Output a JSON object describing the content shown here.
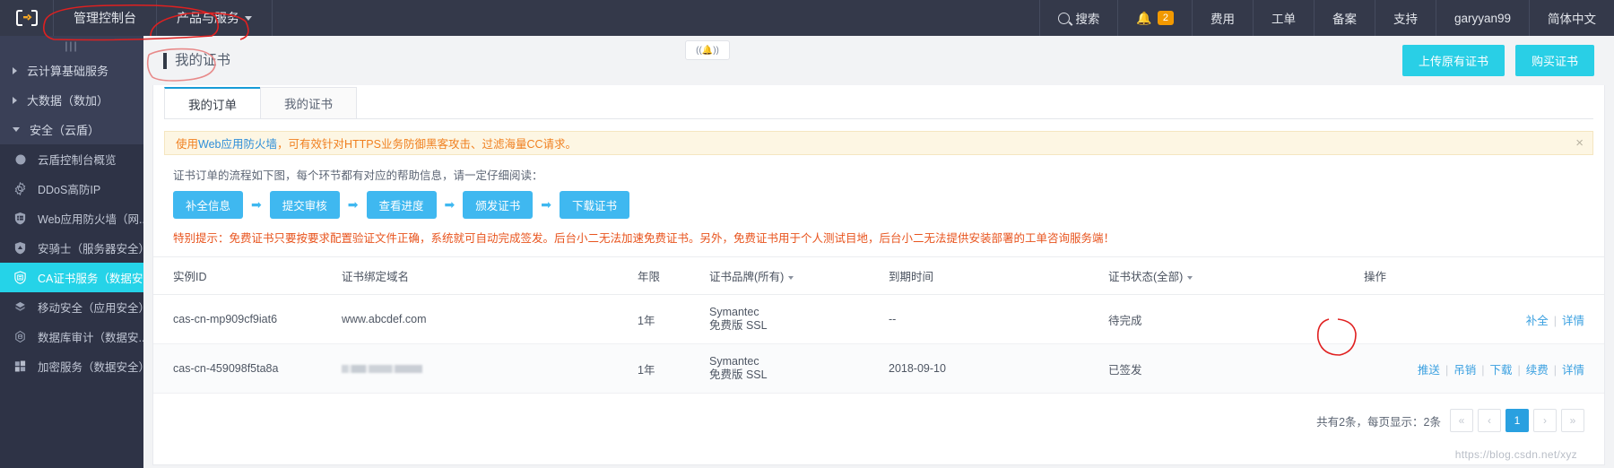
{
  "header": {
    "logo_icon": "cloud-console-logo",
    "left_nav": [
      {
        "label": "管理控制台",
        "icon": null,
        "has_caret": false
      },
      {
        "label": "产品与服务",
        "icon": null,
        "has_caret": true
      }
    ],
    "right_nav": [
      {
        "label": "搜索",
        "icon": "search-icon",
        "badge": null
      },
      {
        "label": "",
        "icon": "bell-icon",
        "badge": "2"
      },
      {
        "label": "费用",
        "icon": null,
        "badge": null
      },
      {
        "label": "工单",
        "icon": null,
        "badge": null
      },
      {
        "label": "备案",
        "icon": null,
        "badge": null
      },
      {
        "label": "支持",
        "icon": null,
        "badge": null
      },
      {
        "label": "garyyan99",
        "icon": null,
        "badge": null
      },
      {
        "label": "简体中文",
        "icon": null,
        "badge": null
      }
    ]
  },
  "sidebar": {
    "collapse_handle": "|||",
    "groups": [
      {
        "label": "云计算基础服务",
        "expanded": false,
        "icon": "triangle-right-icon"
      },
      {
        "label": "大数据（数加）",
        "expanded": false,
        "icon": "triangle-right-icon"
      },
      {
        "label": "安全（云盾）",
        "expanded": true,
        "icon": "triangle-down-icon"
      }
    ],
    "items": [
      {
        "label": "云盾控制台概览",
        "icon": "circle-icon",
        "active": false
      },
      {
        "label": "DDoS高防IP",
        "icon": "gear-icon",
        "active": false
      },
      {
        "label": "Web应用防火墙（网...",
        "icon": "shield-firewall-icon",
        "active": false
      },
      {
        "label": "安骑士（服务器安全）",
        "icon": "shield-server-icon",
        "active": false
      },
      {
        "label": "CA证书服务（数据安...",
        "icon": "shield-certificate-icon",
        "active": true
      },
      {
        "label": "移动安全（应用安全）",
        "icon": "mobile-security-icon",
        "active": false
      },
      {
        "label": "数据库审计（数据安...",
        "icon": "database-audit-icon",
        "active": false
      },
      {
        "label": "加密服务（数据安全）",
        "icon": "encryption-icon",
        "active": false
      }
    ]
  },
  "page": {
    "title": "我的证书",
    "buttons": [
      {
        "label": "上传原有证书",
        "name": "upload-existing-cert-button"
      },
      {
        "label": "购买证书",
        "name": "buy-cert-button"
      }
    ],
    "floating_bell": "((🔔))"
  },
  "tabs": [
    {
      "label": "我的订单",
      "active": true
    },
    {
      "label": "我的证书",
      "active": false
    }
  ],
  "alert": {
    "text_before": "使用",
    "link": "Web应用防火墙",
    "text_after": "，可有效针对HTTPS业务防御黑客攻击、过滤海量CC请求。",
    "close_icon": "close-icon"
  },
  "flow": {
    "intro": "证书订单的流程如下图，每个环节都有对应的帮助信息，请一定仔细阅读：",
    "steps": [
      "补全信息",
      "提交审核",
      "查看进度",
      "颁发证书",
      "下载证书"
    ],
    "arrow": "➡",
    "note": "特别提示：免费证书只要按要求配置验证文件正确，系统就可自动完成签发。后台小二无法加速免费证书。另外，免费证书用于个人测试目地，后台小二无法提供安装部署的工单咨询服务端！"
  },
  "table": {
    "columns": [
      {
        "label": "实例ID",
        "filter": false
      },
      {
        "label": "证书绑定域名",
        "filter": false
      },
      {
        "label": "年限",
        "filter": false
      },
      {
        "label": "证书品牌(所有)",
        "filter": true
      },
      {
        "label": "到期时间",
        "filter": false
      },
      {
        "label": "证书状态(全部)",
        "filter": true
      },
      {
        "label": "操作",
        "filter": false
      }
    ],
    "rows": [
      {
        "instance_id": "cas-cn-mp909cf9iat6",
        "domain": "www.abcdef.com",
        "domain_masked": false,
        "years": "1年",
        "brand_line1": "Symantec",
        "brand_line2": "免费版 SSL",
        "expire": "--",
        "status": "待完成",
        "status_style": "normal",
        "actions": [
          "补全",
          "详情"
        ]
      },
      {
        "instance_id": "cas-cn-459098f5ta8a",
        "domain": "",
        "domain_masked": true,
        "years": "1年",
        "brand_line1": "Symantec",
        "brand_line2": "免费版 SSL",
        "expire": "2018-09-10",
        "status": "已签发",
        "status_style": "green",
        "actions": [
          "推送",
          "吊销",
          "下载",
          "续费",
          "详情"
        ]
      }
    ]
  },
  "pagination": {
    "summary": "共有2条，每页显示：2条",
    "first": "«",
    "prev": "‹",
    "current": "1",
    "next": "›",
    "last": "»"
  },
  "watermark": "https://blog.csdn.net/xyz",
  "colors": {
    "accent_cyan": "#29cfe6",
    "link_blue": "#3aa0e0",
    "step_blue": "#3fb8f0",
    "warn_orange": "#e8541e",
    "status_green": "#2db37a",
    "header_bg": "#34394a",
    "sidebar_bg": "#2e3346",
    "badge_orange": "#f29900"
  }
}
